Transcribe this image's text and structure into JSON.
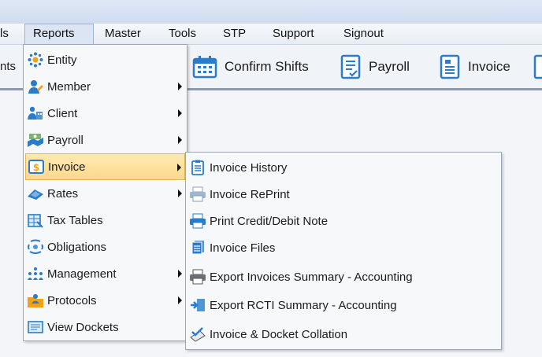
{
  "menubar": {
    "items": [
      {
        "label": "ls"
      },
      {
        "label": "Reports"
      },
      {
        "label": "Master"
      },
      {
        "label": "Tools"
      },
      {
        "label": "STP"
      },
      {
        "label": "Support"
      },
      {
        "label": "Signout"
      }
    ]
  },
  "toolbar": {
    "left_fragment": "nts",
    "buttons": [
      {
        "label": "Confirm Shifts"
      },
      {
        "label": "Payroll"
      },
      {
        "label": "Invoice"
      }
    ]
  },
  "reports_menu": {
    "items": [
      {
        "label": "Entity",
        "icon": "entity-icon",
        "submenu": false
      },
      {
        "label": "Member",
        "icon": "member-icon",
        "submenu": true
      },
      {
        "label": "Client",
        "icon": "client-icon",
        "submenu": true
      },
      {
        "label": "Payroll",
        "icon": "payroll-icon",
        "submenu": true
      },
      {
        "label": "Invoice",
        "icon": "invoice-icon",
        "submenu": true,
        "highlighted": true
      },
      {
        "label": "Rates",
        "icon": "rates-icon",
        "submenu": true
      },
      {
        "label": "Tax Tables",
        "icon": "tax-tables-icon",
        "submenu": false
      },
      {
        "label": "Obligations",
        "icon": "obligations-icon",
        "submenu": false
      },
      {
        "label": "Management",
        "icon": "management-icon",
        "submenu": true
      },
      {
        "label": "Protocols",
        "icon": "protocols-icon",
        "submenu": true
      },
      {
        "label": "View Dockets",
        "icon": "view-dockets-icon",
        "submenu": false
      }
    ]
  },
  "invoice_submenu": {
    "items": [
      {
        "label": "Invoice History",
        "icon": "clipboard-list-icon"
      },
      {
        "label": "Invoice RePrint",
        "icon": "printer-icon"
      },
      {
        "label": "Print Credit/Debit Note",
        "icon": "printer-blue-icon"
      },
      {
        "label": "Invoice Files",
        "icon": "files-stack-icon"
      },
      {
        "label": "Export Invoices Summary - Accounting",
        "icon": "export-printer-icon"
      },
      {
        "label": "Export RCTI Summary - Accounting",
        "icon": "export-arrow-icon"
      },
      {
        "label": "Invoice & Docket Collation",
        "icon": "document-check-icon"
      }
    ]
  },
  "colors": {
    "highlight": "#fcd98c",
    "menu_bg": "#f7f8fa",
    "toolbar_bg": "#f0f3f8"
  }
}
